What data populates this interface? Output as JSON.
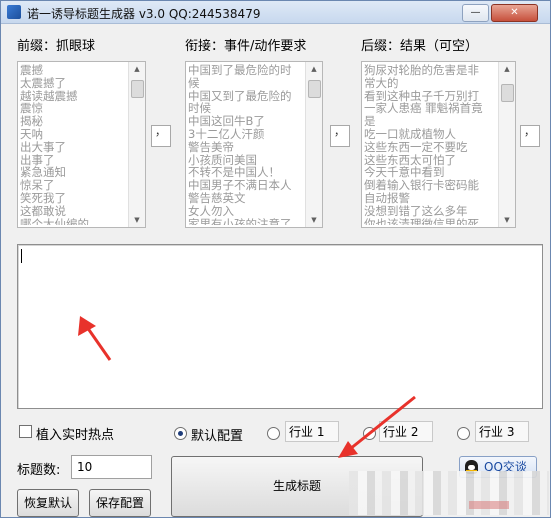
{
  "window": {
    "title": "诺一诱导标题生成器 v3.0 QQ:244538479",
    "minimize_glyph": "—",
    "close_glyph": "✕"
  },
  "columns": {
    "prefix": {
      "label": "前缀：抓眼球",
      "items": [
        "震撼",
        "太震撼了",
        "越读越震撼",
        "震惊",
        "揭秘",
        "天呐",
        "出大事了",
        "出事了",
        "紧急通知",
        "惊呆了",
        "笑死我了",
        "这都敢说",
        "哪个大仙编的"
      ]
    },
    "separator1": {
      "value": "，"
    },
    "middle": {
      "label": "衔接：事件/动作要求",
      "items": [
        "中国到了最危险的时",
        "候",
        "中国又到了最危险的",
        "时候",
        "中国这回牛B了",
        "3十二亿人汗颜",
        "警告美帝",
        "小孩质问美国",
        "不转不是中国人！",
        "中国男子不满日本人",
        "警告慈英文",
        "女人勿入",
        "家里有小孩的注意了"
      ]
    },
    "separator2": {
      "value": "，"
    },
    "suffix": {
      "label": "后缀：结果（可空）",
      "items": [
        "狗尿对轮胎的危害是非",
        "常大的",
        "看到这种虫子千万别打",
        "一家人患癌 罪魁祸首竟",
        "是",
        "吃一口就成植物人",
        "这些东西一定不要吃",
        "这些东西太可怕了",
        "今天千意中看到",
        "倒着输入银行卡密码能",
        "自动报警",
        "没想到错了这么多年",
        "你也该清理微信里的死"
      ]
    },
    "separator3": {
      "value": "，"
    }
  },
  "output": {
    "text": ""
  },
  "options": {
    "realtime_hotspot_label": "植入实时热点",
    "default_config_label": "默认配置",
    "industry1_label": "行业 1",
    "industry2_label": "行业 2",
    "industry3_label": "行业 3",
    "selected": "default"
  },
  "controls": {
    "title_count_label": "标题数:",
    "title_count_value": "10",
    "generate_label": "生成标题",
    "restore_default_label": "恢复默认",
    "save_config_label": "保存配置",
    "qq_chat_label": "QQ交谈"
  },
  "colors": {
    "annotation_arrow": "#e8322b",
    "list_text": "#9a9a9a"
  }
}
